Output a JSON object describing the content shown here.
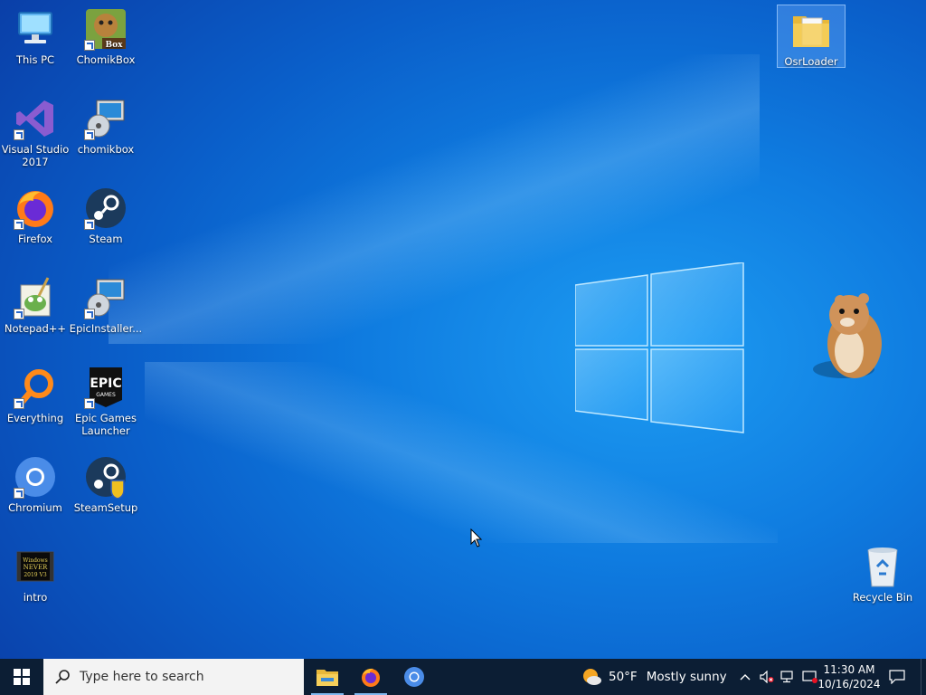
{
  "desktop": {
    "icons": [
      {
        "label": "This PC",
        "icon": "computer-icon"
      },
      {
        "label": "ChomikBox",
        "icon": "chomikbox-icon"
      },
      {
        "label": "Visual Studio 2017",
        "icon": "visual-studio-icon"
      },
      {
        "label": "chomikbox",
        "icon": "installer-icon"
      },
      {
        "label": "Firefox",
        "icon": "firefox-icon"
      },
      {
        "label": "Steam",
        "icon": "steam-icon"
      },
      {
        "label": "Notepad++",
        "icon": "notepadpp-icon"
      },
      {
        "label": "EpicInstaller...",
        "icon": "installer-icon"
      },
      {
        "label": "Everything",
        "icon": "everything-icon"
      },
      {
        "label": "Epic Games Launcher",
        "icon": "epic-games-icon"
      },
      {
        "label": "Chromium",
        "icon": "chromium-icon"
      },
      {
        "label": "SteamSetup",
        "icon": "steam-setup-icon"
      },
      {
        "label": "intro",
        "icon": "video-icon"
      },
      {
        "label": "OsrLoader",
        "icon": "folder-icon"
      },
      {
        "label": "Recycle Bin",
        "icon": "recycle-bin-icon"
      }
    ],
    "chomikbox_badge": "Box",
    "epic_logo_text": "EPIC",
    "epic_logo_sub": "GAMES",
    "intro_thumb_text": "Windows NEVER 2019 V3"
  },
  "taskbar": {
    "search_placeholder": "Type here to search",
    "apps": [
      "file-explorer-icon",
      "firefox-icon",
      "chromium-icon"
    ],
    "weather_temp": "50°F",
    "weather_desc": "Mostly sunny",
    "time": "11:30 AM",
    "date": "10/16/2024"
  },
  "colors": {
    "taskbar_bg": "#0c1e34",
    "desktop_accent": "#0f7ce0"
  }
}
